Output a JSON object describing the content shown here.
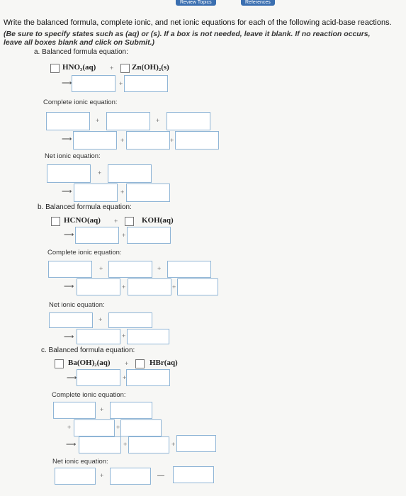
{
  "header": {
    "review_topics": "Review Topics",
    "references": "References"
  },
  "instructions": {
    "line1": "Write the balanced formula, complete ionic, and net ionic equations for each of the following acid-base reactions.",
    "line2": "(Be sure to specify states such as (aq) or (s). If a box is not needed, leave it blank. If no reaction occurs,",
    "line3": "leave all boxes blank and click on Submit.)"
  },
  "symbols": {
    "plus": "+",
    "arrow": "⟶",
    "dash": "—"
  },
  "part_a": {
    "heading": "a. Balanced formula equation:",
    "reactant1": "HNO₃(aq)",
    "reactant2": "Zn(OH)₂(s)",
    "complete_label": "Complete ionic equation:",
    "net_label": "Net ionic equation:"
  },
  "part_b": {
    "heading": "b. Balanced formula equation:",
    "reactant1": "HCNO(aq)",
    "reactant2": "KOH(aq)",
    "complete_label": "Complete ionic equation:",
    "net_label": "Net ionic equation:"
  },
  "part_c": {
    "heading": "c. Balanced formula equation:",
    "reactant1": "Ba(OH)₂(aq)",
    "reactant2": "HBr(aq)",
    "complete_label": "Complete ionic equation:",
    "net_label": "Net ionic equation:"
  }
}
